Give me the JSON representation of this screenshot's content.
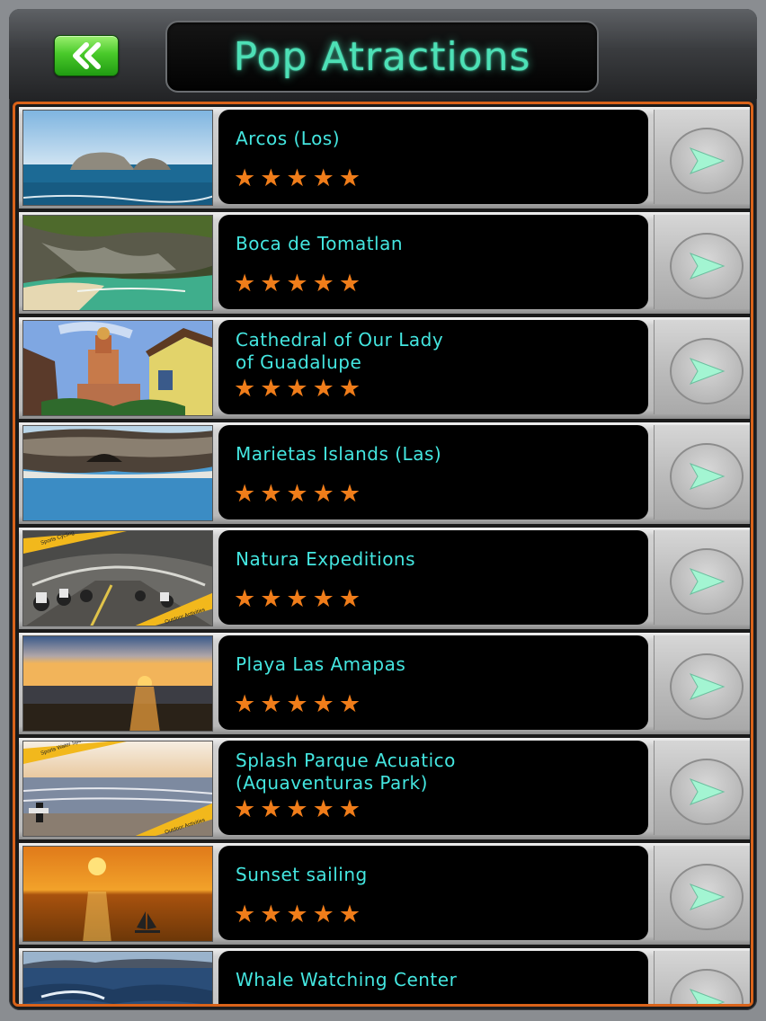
{
  "header": {
    "title": "Pop Atractions",
    "back_icon": "double-chevron-left-icon"
  },
  "attractions": [
    {
      "name": "Arcos (Los)",
      "rating": "★★★★★",
      "thumb": "rock-islands-sea"
    },
    {
      "name": "Boca de Tomatlan",
      "rating": "★★★★★",
      "thumb": "rocky-cove-beach"
    },
    {
      "name": "Cathedral of Our Lady\nof Guadalupe",
      "rating": "★★★★★",
      "thumb": "cathedral-tower"
    },
    {
      "name": "Marietas Islands (Las)",
      "rating": "★★★★★",
      "thumb": "island-cave-sea"
    },
    {
      "name": "Natura Expeditions",
      "rating": "★★★★★",
      "thumb": "cyclists-tunnel",
      "banners": [
        "Sports\nCycling",
        "Outdoor Activities"
      ]
    },
    {
      "name": "Playa Las Amapas",
      "rating": "★★★★★",
      "thumb": "sunset-beach"
    },
    {
      "name": "Splash Parque Acuatico\n(Aquaventuras Park)",
      "rating": "★★★★★",
      "thumb": "surfer-beach",
      "banners": [
        "Sports\nWater Sports",
        "Outdoor Activities"
      ]
    },
    {
      "name": "Sunset sailing",
      "rating": "★★★★★",
      "thumb": "sunset-sailboat"
    },
    {
      "name": "Whale Watching Center",
      "rating": "★★★★★",
      "thumb": "whale-waves"
    }
  ],
  "colors": {
    "accent_orange": "#d9631a",
    "title_glow": "#4de0b6",
    "name_text": "#44e6e0",
    "star": "#f07d1a",
    "back_green": "#49c92a"
  },
  "icons": {
    "go": "play-arrow-icon",
    "rating": "star-icon"
  }
}
